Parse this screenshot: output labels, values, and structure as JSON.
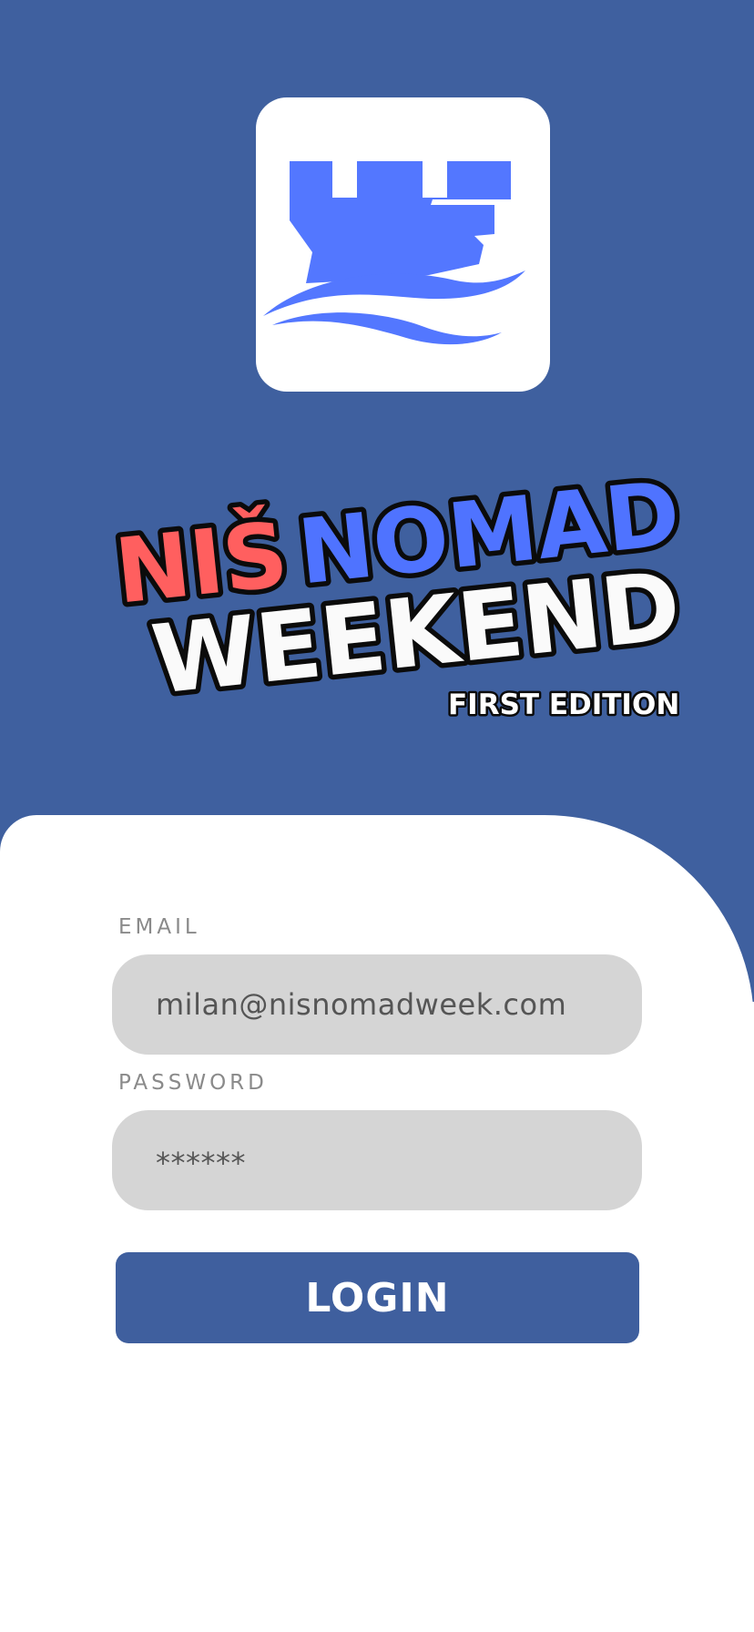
{
  "brand": {
    "word_1": "NIŠ",
    "word_2": "NOMAD",
    "word_3": "WEEKEND",
    "edition": "FIRST EDITION",
    "logo_icon": "castle-tower-waves-icon"
  },
  "form": {
    "email_label": "EMAIL",
    "email_value": "milan@nisnomadweek.com",
    "password_label": "PASSWORD",
    "password_value": "******",
    "login_label": "LOGIN"
  },
  "colors": {
    "hero_background": "#3f609f",
    "accent_red": "#ff5f5f",
    "accent_blue": "#4f73ff",
    "button": "#3f5f9e",
    "field_background": "#d5d5d5"
  }
}
